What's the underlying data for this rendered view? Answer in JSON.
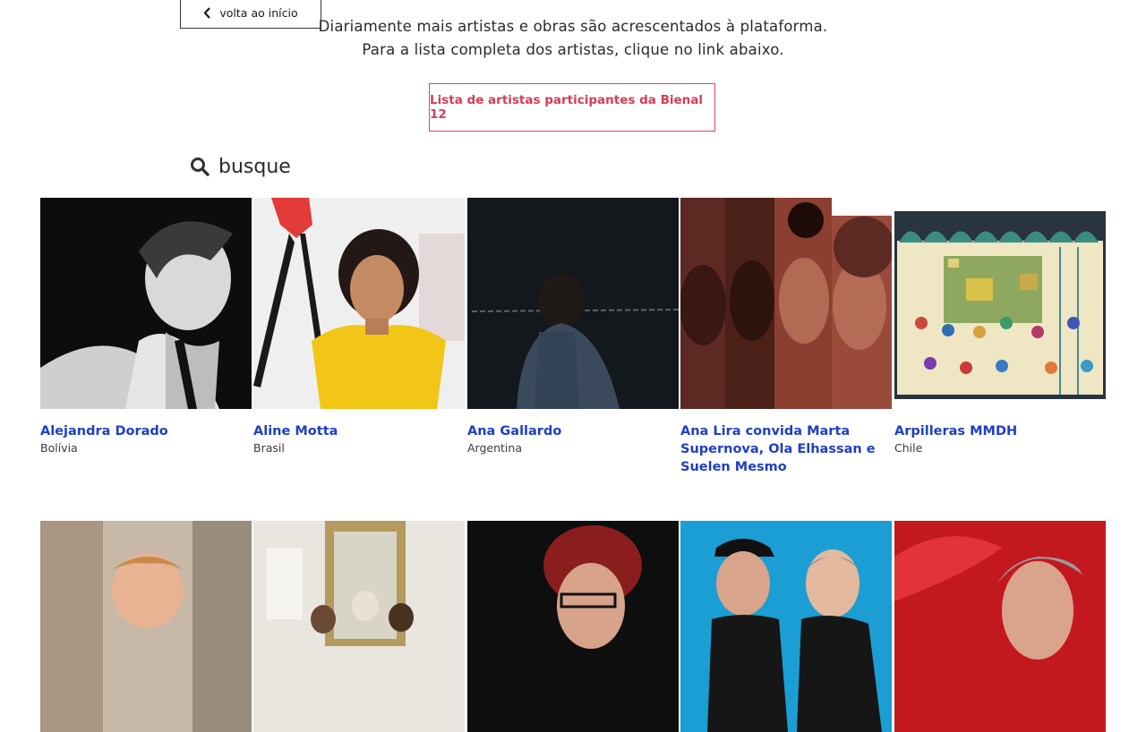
{
  "nav": {
    "back_label": "volta ao início"
  },
  "intro": {
    "line1": "Diariamente mais artistas e obras são acrescentados à plataforma.",
    "line2": "Para a lista completa dos artistas, clique no link abaixo."
  },
  "list_button": {
    "label": "Lista de artistas participantes da Bienal 12"
  },
  "search": {
    "placeholder": "busque",
    "icon": "search-icon"
  },
  "artists": [
    {
      "name": "Alejandra Dorado",
      "country": "Bolívia"
    },
    {
      "name": "Aline Motta",
      "country": "Brasil"
    },
    {
      "name": "Ana Gallardo",
      "country": "Argentina"
    },
    {
      "name": "Ana Lira convida Marta Supernova, Ola Elhassan e Suelen Mesmo",
      "country": ""
    },
    {
      "name": "Arpilleras MMDH",
      "country": "Chile"
    }
  ],
  "colors": {
    "accent_red": "#d43d55",
    "link_blue": "#1f3fc4"
  }
}
